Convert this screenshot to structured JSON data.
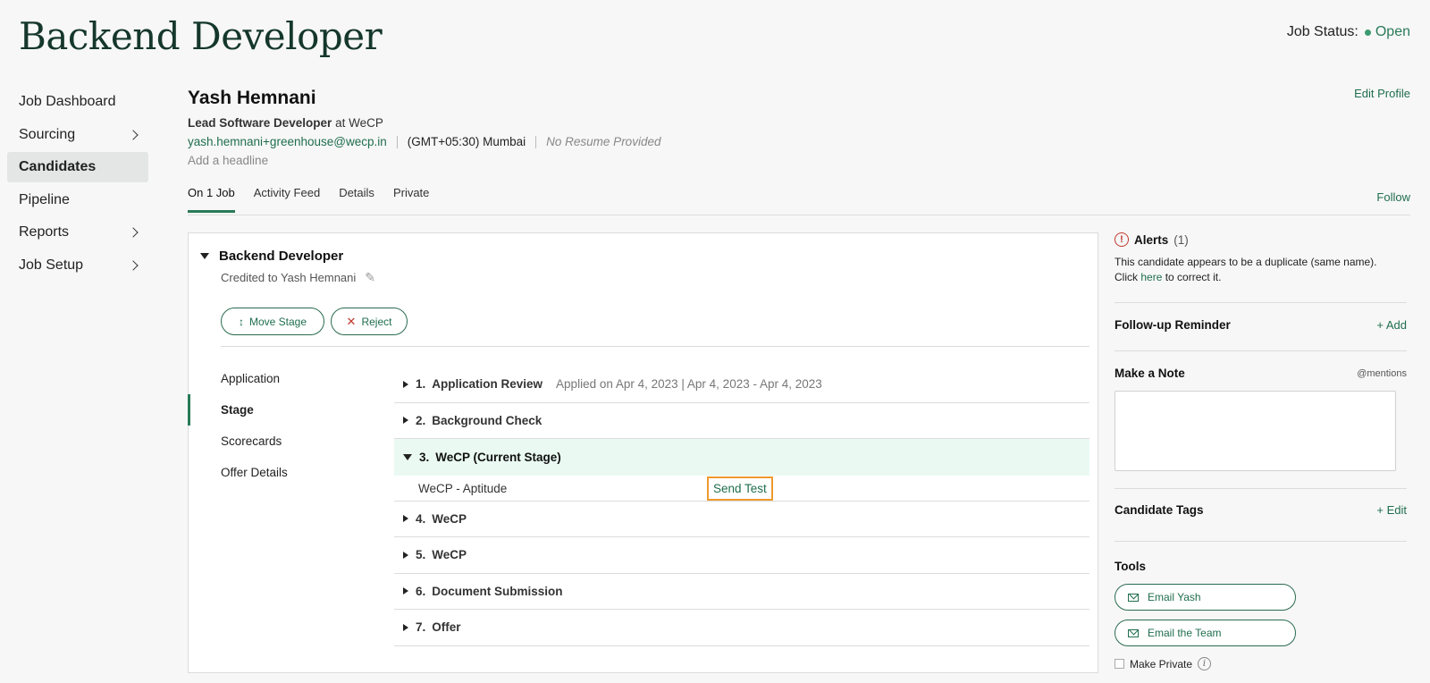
{
  "header": {
    "title": "Backend Developer",
    "job_status_label": "Job Status:",
    "job_status_value": "Open"
  },
  "sidebar": {
    "items": [
      {
        "label": "Job Dashboard",
        "has_chevron": false
      },
      {
        "label": "Sourcing",
        "has_chevron": true
      },
      {
        "label": "Candidates",
        "has_chevron": false,
        "active": true
      },
      {
        "label": "Pipeline",
        "has_chevron": false
      },
      {
        "label": "Reports",
        "has_chevron": true
      },
      {
        "label": "Job Setup",
        "has_chevron": true
      }
    ]
  },
  "candidate": {
    "name": "Yash Hemnani",
    "title": "Lead Software Developer",
    "at": "at",
    "company": "WeCP",
    "email": "yash.hemnani+greenhouse@wecp.in",
    "timezone": "(GMT+05:30) Mumbai",
    "resume": "No Resume Provided",
    "headline_placeholder": "Add a headline",
    "edit_profile": "Edit Profile"
  },
  "tabs": {
    "items": [
      "On 1 Job",
      "Activity Feed",
      "Details",
      "Private"
    ],
    "active": "On 1 Job",
    "follow": "Follow"
  },
  "job_card": {
    "job_name": "Backend Developer",
    "credited": "Credited to Yash Hemnani",
    "move_stage": "Move Stage",
    "reject": "Reject",
    "subnav": [
      "Application",
      "Stage",
      "Scorecards",
      "Offer Details"
    ],
    "subnav_active": "Stage",
    "stages": [
      {
        "num": "1.",
        "name": "Application Review",
        "meta": "Applied on Apr 4, 2023 | Apr 4, 2023 - Apr 4, 2023"
      },
      {
        "num": "2.",
        "name": "Background Check"
      },
      {
        "num": "3.",
        "name": "WeCP (Current Stage)",
        "current": true
      },
      {
        "num": "4.",
        "name": "WeCP"
      },
      {
        "num": "5.",
        "name": "WeCP"
      },
      {
        "num": "6.",
        "name": "Document Submission"
      },
      {
        "num": "7.",
        "name": "Offer"
      }
    ],
    "current_sub": {
      "name": "WeCP - Aptitude",
      "action": "Send Test"
    }
  },
  "right_panel": {
    "alerts_title": "Alerts",
    "alerts_count": "(1)",
    "alerts_line1": "This candidate appears to be a duplicate (same name).",
    "alerts_click": "Click",
    "alerts_here": "here",
    "alerts_rest": "to correct it.",
    "followup_title": "Follow-up Reminder",
    "followup_action": "+ Add",
    "note_title": "Make a Note",
    "note_mentions": "@mentions",
    "tags_title": "Candidate Tags",
    "tags_action": "+ Edit",
    "tools_title": "Tools",
    "email_candidate": "Email Yash",
    "email_team": "Email the Team",
    "make_private": "Make Private"
  },
  "colors": {
    "accent": "#1f6e4e",
    "current_stage_bg": "#eafaf3",
    "highlight_border": "#ef9a2f",
    "alert": "#c0392b"
  }
}
